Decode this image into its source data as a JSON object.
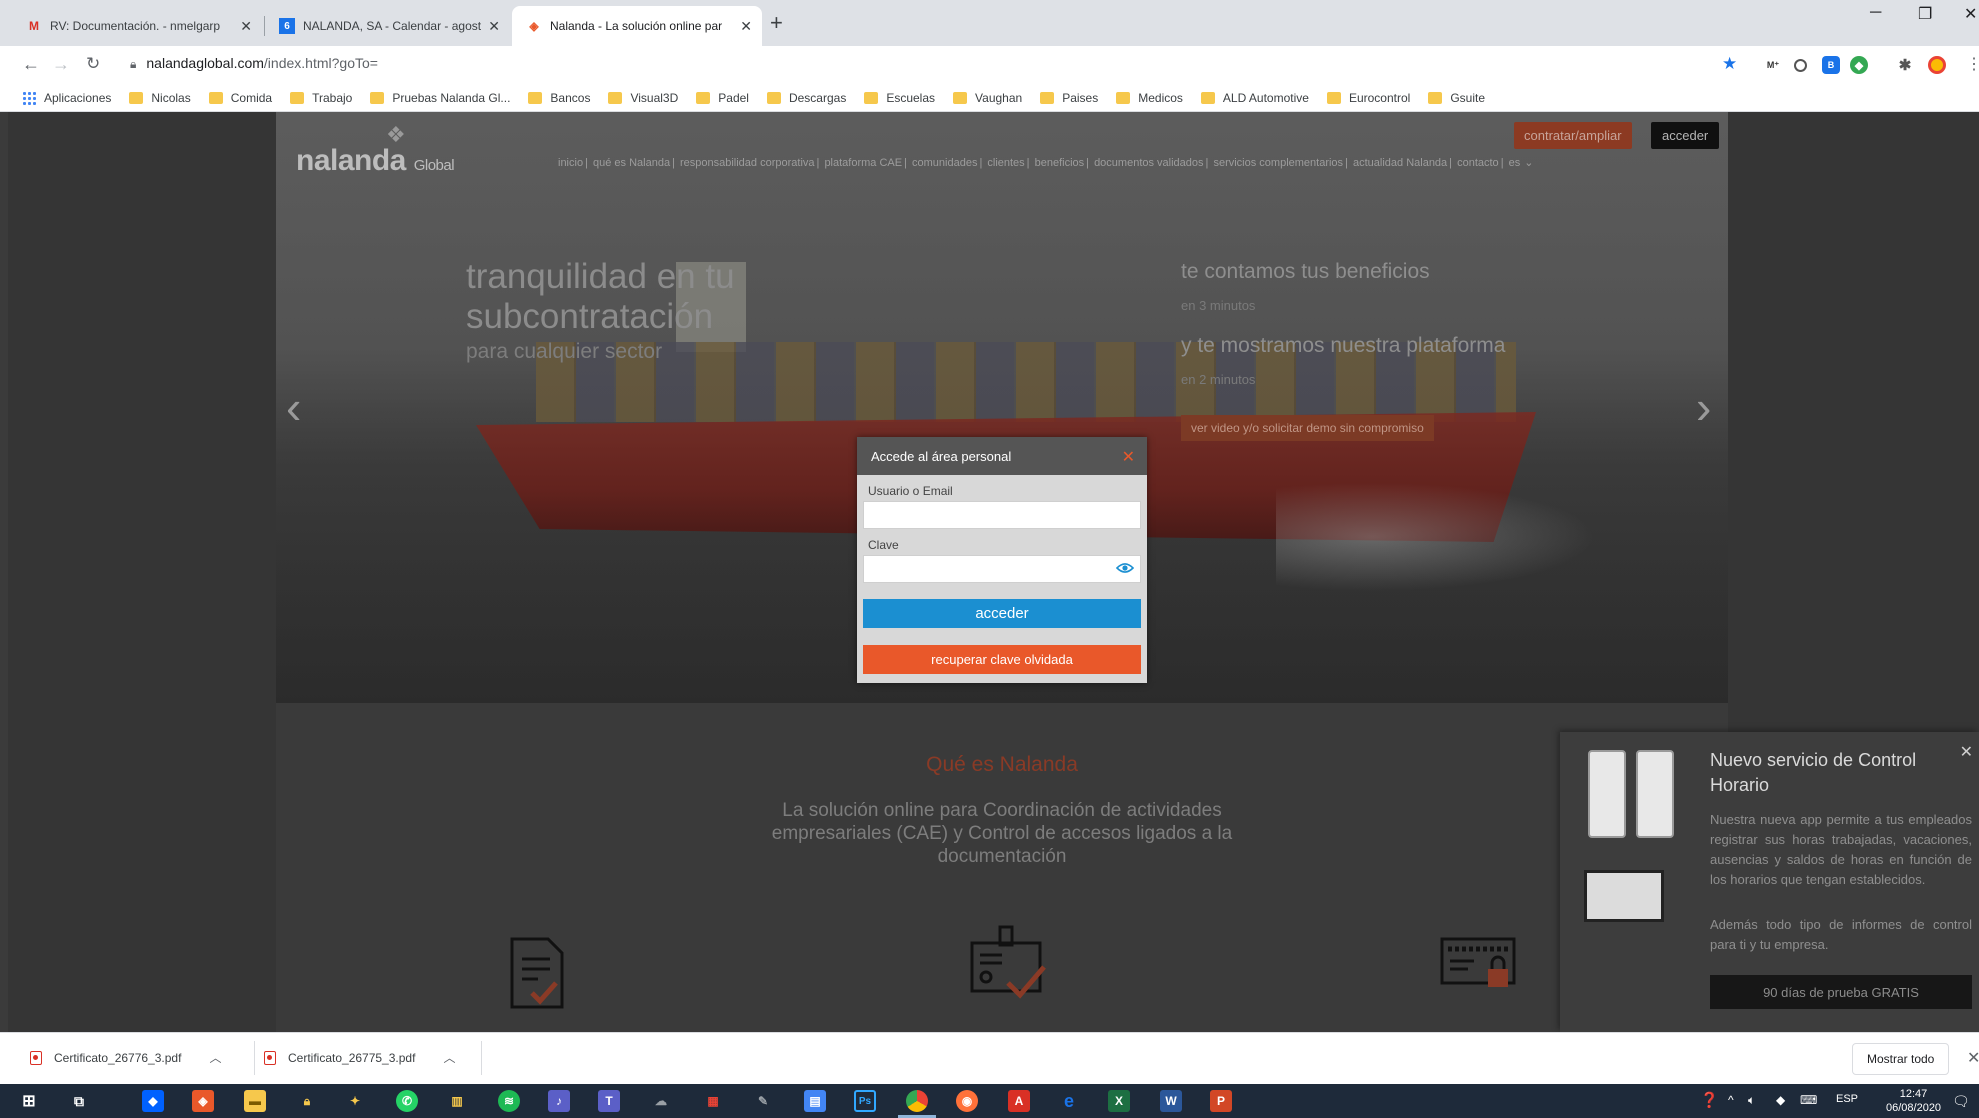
{
  "browser": {
    "tabs": [
      {
        "label": "RV: Documentación. - nmelgarp",
        "icon": "gmail-icon",
        "active": false
      },
      {
        "label": "NALANDA, SA - Calendar - agost",
        "icon": "calendar-icon",
        "active": false
      },
      {
        "label": "Nalanda - La solución online par",
        "icon": "nalanda-icon",
        "active": true
      }
    ],
    "address": {
      "domain": "nalandaglobal.com",
      "path": "/index.html?goTo="
    },
    "bookmarks": [
      "Aplicaciones",
      "Nicolas",
      "Comida",
      "Trabajo",
      "Pruebas Nalanda Gl...",
      "Bancos",
      "Visual3D",
      "Padel",
      "Descargas",
      "Escuelas",
      "Vaughan",
      "Paises",
      "Medicos",
      "ALD Automotive",
      "Eurocontrol",
      "Gsuite"
    ]
  },
  "site": {
    "logo": "nalanda",
    "logo_sub": "Global",
    "nav": [
      "inicio",
      "qué es Nalanda",
      "responsabilidad corporativa",
      "plataforma CAE",
      "comunidades",
      "clientes",
      "beneficios",
      "documentos validados",
      "servicios complementarios",
      "actualidad Nalanda",
      "contacto",
      "es"
    ],
    "btn_contratar": "contratar/ampliar",
    "btn_acceder": "acceder",
    "hero_title_1": "tranquilidad en tu",
    "hero_title_2": "subcontratación",
    "hero_sub": "para cualquier sector",
    "promo1": "te contamos tus beneficios",
    "promo1_sub": "en 3 minutos",
    "promo2": "y te mostramos nuestra plataforma",
    "promo2_sub": "en 2 minutos",
    "video_btn": "ver video y/o solicitar demo sin compromiso",
    "qes_title": "Qué es Nalanda",
    "qes_desc": "La solución online para Coordinación de actividades empresariales (CAE) y Control de accesos ligados a la documentación"
  },
  "login": {
    "title": "Accede al área personal",
    "user_label": "Usuario o Email",
    "user_value": "",
    "pass_label": "Clave",
    "pass_value": "",
    "submit": "acceder",
    "recover": "recuperar clave olvidada"
  },
  "promo_panel": {
    "title": "Nuevo servicio de Control Horario",
    "text": "Nuestra nueva app permite a tus empleados registrar sus horas trabajadas, vacaciones, ausencias y saldos de horas en función de los horarios que tengan establecidos.",
    "text2": "Además todo tipo de informes de control para ti y tu empresa.",
    "button": "90 días de prueba GRATIS"
  },
  "downloads": {
    "items": [
      "Certificato_26776_3.pdf",
      "Certificato_26775_3.pdf"
    ],
    "show_all": "Mostrar todo"
  },
  "taskbar": {
    "lang": "ESP",
    "time": "12:47",
    "date": "06/08/2020"
  },
  "colors": {
    "accent_orange": "#e9582a",
    "accent_blue": "#1b8fd1"
  }
}
